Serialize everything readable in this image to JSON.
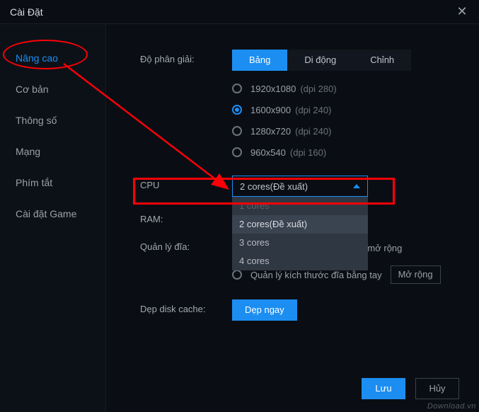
{
  "window": {
    "title": "Cài Đặt"
  },
  "sidebar": {
    "items": [
      {
        "label": "Nâng cao"
      },
      {
        "label": "Cơ bản"
      },
      {
        "label": "Thông số"
      },
      {
        "label": "Mạng"
      },
      {
        "label": "Phím tắt"
      },
      {
        "label": "Cài đặt Game"
      }
    ]
  },
  "resolution": {
    "label": "Độ phân giải:",
    "tabs": [
      {
        "label": "Bảng"
      },
      {
        "label": "Di động"
      },
      {
        "label": "Chỉnh"
      }
    ],
    "options": [
      {
        "res": "1920x1080",
        "dpi": "(dpi 280)"
      },
      {
        "res": "1600x900",
        "dpi": "(dpi 240)"
      },
      {
        "res": "1280x720",
        "dpi": "(dpi 240)"
      },
      {
        "res": "960x540",
        "dpi": "(dpi 160)"
      }
    ]
  },
  "cpu": {
    "label": "CPU",
    "selected": "2 cores(Đề xuất)",
    "options": [
      {
        "label": "1 cores"
      },
      {
        "label": "2 cores(Đề xuất)"
      },
      {
        "label": "3 cores"
      },
      {
        "label": "4 cores"
      }
    ]
  },
  "ram": {
    "label": "RAM:"
  },
  "disk": {
    "label": "Quản lý đĩa:",
    "opt_auto": "Không đủ thời gian, tự động mở rộng",
    "opt_manual": "Quản lý kích thước đĩa bằng tay",
    "expand_btn": "Mở rộng"
  },
  "cache": {
    "label": "Dẹp disk cache:",
    "btn": "Dẹp ngay"
  },
  "footer": {
    "save": "Lưu",
    "cancel": "Hủy"
  },
  "watermark": "Download.vn"
}
